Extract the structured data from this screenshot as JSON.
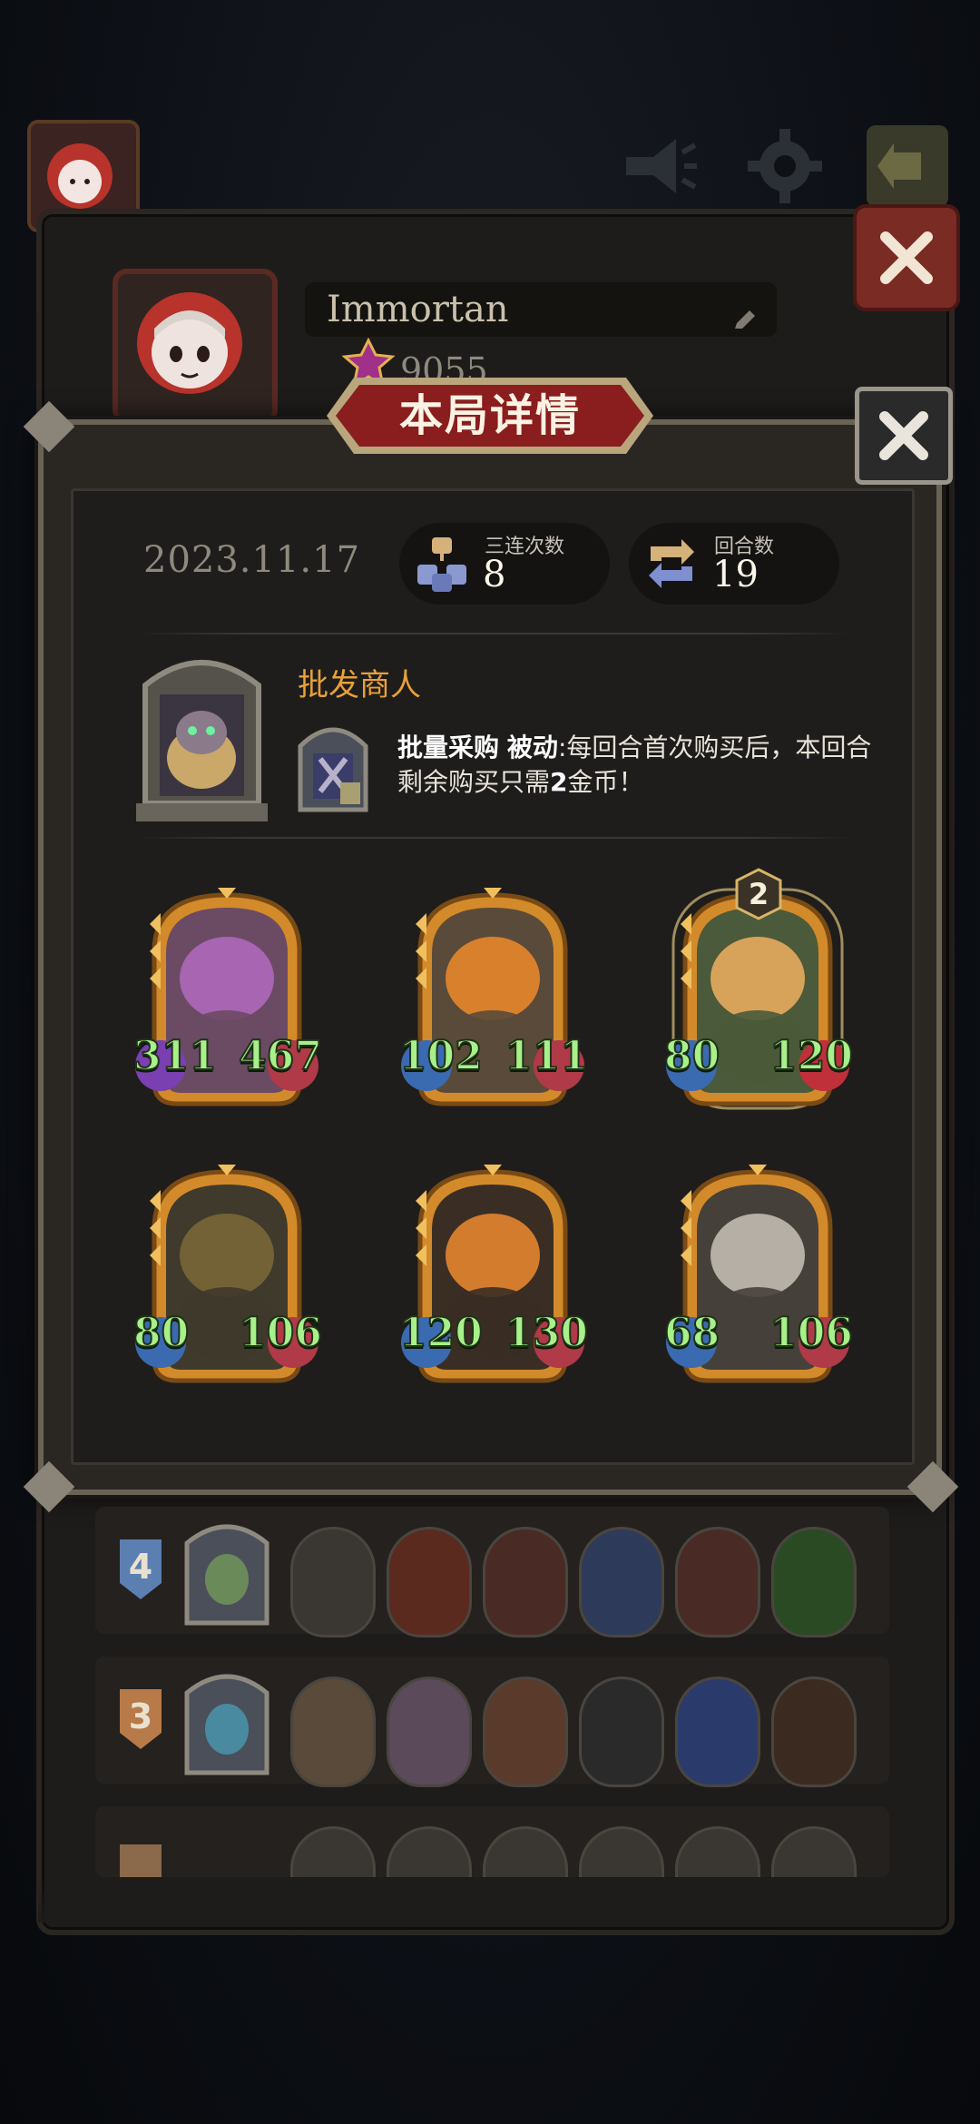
{
  "profile": {
    "name": "Immortan",
    "score": "9055"
  },
  "modal": {
    "title": "本局详情",
    "date": "2023.11.17",
    "stats": [
      {
        "label": "三连次数",
        "value": "8",
        "icon": "triple-merge-icon"
      },
      {
        "label": "回合数",
        "value": "19",
        "icon": "rounds-cycle-icon"
      }
    ],
    "hero": {
      "name": "批发商人",
      "skill_name": "批量采购",
      "skill_type": "被动",
      "skill_desc": ":每回合首次购买后，本回合剩余购买只需",
      "skill_value": "2",
      "skill_tail": "金币！"
    },
    "units": [
      {
        "name": "mushroom-unit",
        "atk": "311",
        "hp": "467",
        "stars": null,
        "colors": {
          "bg": "#6b4a63",
          "accent": "#b26ac0"
        }
      },
      {
        "name": "pumpkin-ghost-unit",
        "atk": "102",
        "hp": "111",
        "stars": null,
        "colors": {
          "bg": "#5a4a3a",
          "accent": "#f08a2a"
        }
      },
      {
        "name": "flower-dryad-unit",
        "atk": "80",
        "hp": "120",
        "stars": "2",
        "colors": {
          "bg": "#4a5a3a",
          "accent": "#f0b060"
        }
      },
      {
        "name": "witch-hat-unit",
        "atk": "80",
        "hp": "106",
        "stars": null,
        "colors": {
          "bg": "#3f3a2c",
          "accent": "#7d6a38"
        }
      },
      {
        "name": "treant-unit",
        "atk": "120",
        "hp": "130",
        "stars": null,
        "colors": {
          "bg": "#3a2e24",
          "accent": "#f08a30"
        }
      },
      {
        "name": "barbarian-unit",
        "atk": "68",
        "hp": "106",
        "stars": null,
        "colors": {
          "bg": "#45403a",
          "accent": "#c9c3b8"
        }
      }
    ]
  },
  "ranking": [
    {
      "rank": "4",
      "badge_color": "#5b7fb0",
      "text_color": "#ffffff"
    },
    {
      "rank": "3",
      "badge_color": "#b77a48",
      "text_color": "#ffffff"
    },
    {
      "rank": "",
      "badge_color": "#8a6a4a",
      "text_color": "#ffffff"
    }
  ],
  "colors": {
    "stat_green": "#a8f08a",
    "hero_name": "#e8a03a",
    "title_banner": "#8a1d1d"
  }
}
